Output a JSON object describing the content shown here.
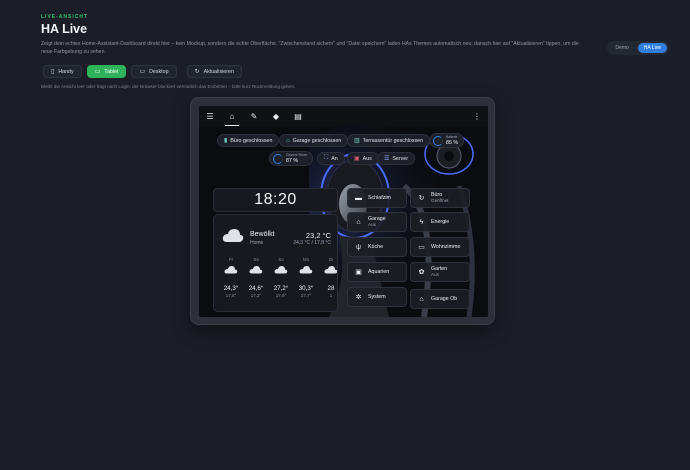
{
  "page": {
    "eyebrow": "LIVE-ANSICHT",
    "title": "HA Live",
    "description": "Zeigt dein echtes Home-Assistant-Dashboard direkt hier – kein Mockup, sondern die echte Oberfläche. \"Zwischenstand sichern\" und \"Datei speichern\" laden HAs Themes automatisch neu; danach hier auf \"Aktualisieren\" tippen, um die neue Farbgebung zu sehen.",
    "hint": "Bleibt die Ansicht leer oder fragt nach Login: der Browser blockiert vermutlich das Einbetten – bitte kurz Rückmeldung geben."
  },
  "mode_switch": {
    "demo": "Demo",
    "live": "HA Live",
    "active": "live"
  },
  "toolbar": {
    "handy": "Handy",
    "tablet": "Tablet",
    "desktop": "Desktop",
    "refresh": "Aktualisieren",
    "active": "tablet"
  },
  "ha": {
    "header_icons": [
      "menu-icon",
      "home-icon",
      "pencil-icon",
      "paint-icon",
      "trash-icon",
      "more-icon"
    ],
    "chips": {
      "buero": "Büro geschlossen",
      "garage": "Garage geschlossen",
      "terrasse": "Terrassentür geschlossen",
      "an": "An",
      "aus": "Aus",
      "server": "Server"
    },
    "gauges": {
      "g1_label": "Gesamt Strom",
      "g1_value": "87 %",
      "g2_label": "Batterie",
      "g2_value": "85 %"
    },
    "clock": "18:20",
    "weather": {
      "condition": "Bewölkt",
      "location": "Home",
      "temp": "23,2 °C",
      "range": "24,3 °C / 17,8 °C",
      "forecast": [
        {
          "day": "Fr",
          "hi": "24,3°",
          "lo": "17,8°"
        },
        {
          "day": "Sa",
          "hi": "24,6°",
          "lo": "17,2°"
        },
        {
          "day": "So",
          "hi": "27,2°",
          "lo": "17,9°"
        },
        {
          "day": "Mo",
          "hi": "30,3°",
          "lo": "17,7°"
        },
        {
          "day": "Di",
          "hi": "28",
          "lo": "1"
        }
      ]
    },
    "tiles": {
      "schlafzimmer": {
        "name": "Schlafzim",
        "state": ""
      },
      "buero": {
        "name": "Büro",
        "state": "Geöffnet"
      },
      "garage": {
        "name": "Garage",
        "state": "Aus"
      },
      "energie": {
        "name": "Energie",
        "state": ""
      },
      "kueche": {
        "name": "Küche",
        "state": ""
      },
      "wohnzimmer": {
        "name": "Wohnzimme",
        "state": ""
      },
      "aquarien": {
        "name": "Aquarien",
        "state": ""
      },
      "garten": {
        "name": "Garten",
        "state": "Aus"
      },
      "system": {
        "name": "System",
        "state": ""
      },
      "garage_ob": {
        "name": "Garage Ob",
        "state": ""
      }
    }
  },
  "colors": {
    "accent_green": "#35c46a",
    "accent_blue": "#2f7fe0",
    "background": "#1b1e27"
  }
}
